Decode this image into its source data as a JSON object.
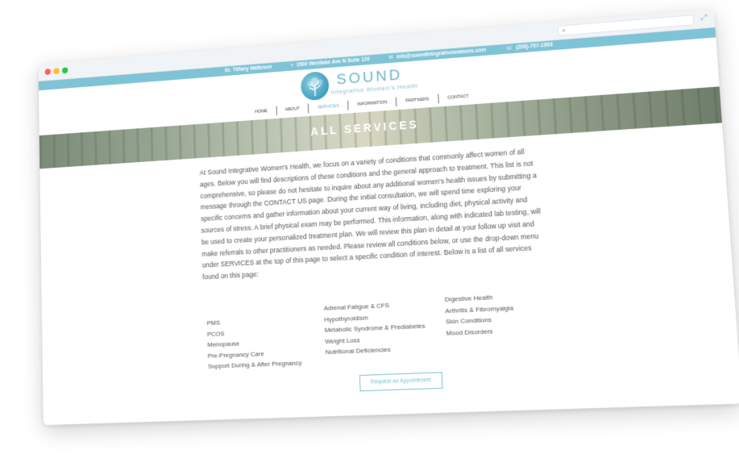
{
  "topbar": {
    "name": "Dr. Tiffany Matteson",
    "address": "1500 Westlake Ave N Suite 120",
    "email": "info@soundintegrativewomens.com",
    "phone": "(206)-707-1993",
    "icons": {
      "address": "map-pin-icon",
      "email": "envelope-icon",
      "phone": "phone-icon"
    }
  },
  "brand": {
    "name": "SOUND",
    "tagline": "Integrative Women's Health"
  },
  "nav": {
    "items": [
      {
        "label": "HOME"
      },
      {
        "label": "ABOUT"
      },
      {
        "label": "SERVICES"
      },
      {
        "label": "INFORMATION"
      },
      {
        "label": "PARTNERS"
      },
      {
        "label": "CONTACT"
      }
    ],
    "active": "SERVICES"
  },
  "banner": {
    "title": "ALL SERVICES"
  },
  "intro": "At Sound Integrative Women's Health, we focus on a variety of conditions that commonly affect women of all ages. Below you will find descriptions of these conditions and the general approach to treatment. This list is not comprehensive, so please do not hesitate to inquire about any additional women's health issues by submitting a message through the CONTACT US page. During the initial consultation, we will spend time exploring your specific concerns and gather information about your current way of living, including diet, physical activity and sources of stress. A brief physical exam may be performed. This information, along with indicated lab testing, will be used to create your personalized treatment plan. We will review this plan in detail at your follow up visit and make referrals to other practitioners as needed. Please review all conditions below, or use the drop-down menu under SERVICES at the top of this page to select a specific condition of interest. Below is a list of all services found on this page:",
  "services": {
    "col1": [
      "PMS",
      "PCOS",
      "Menopause",
      "Pre-Pregnancy Care",
      "Support During & After Pregnancy"
    ],
    "col2": [
      "Adrenal Fatigue & CFS",
      "Hypothyroidism",
      "Metabolic Syndrome & Prediabetes",
      "Weight Loss",
      "Nutritional Deficiencies"
    ],
    "col3": [
      "Digestive Health",
      "Arthritis & Fibromyalgia",
      "Skin Conditions",
      "Mood Disorders"
    ]
  },
  "cta": {
    "label": "Request an Appointment"
  },
  "colors": {
    "accent": "#7fc3d6",
    "brand": "#6cb6cf"
  }
}
